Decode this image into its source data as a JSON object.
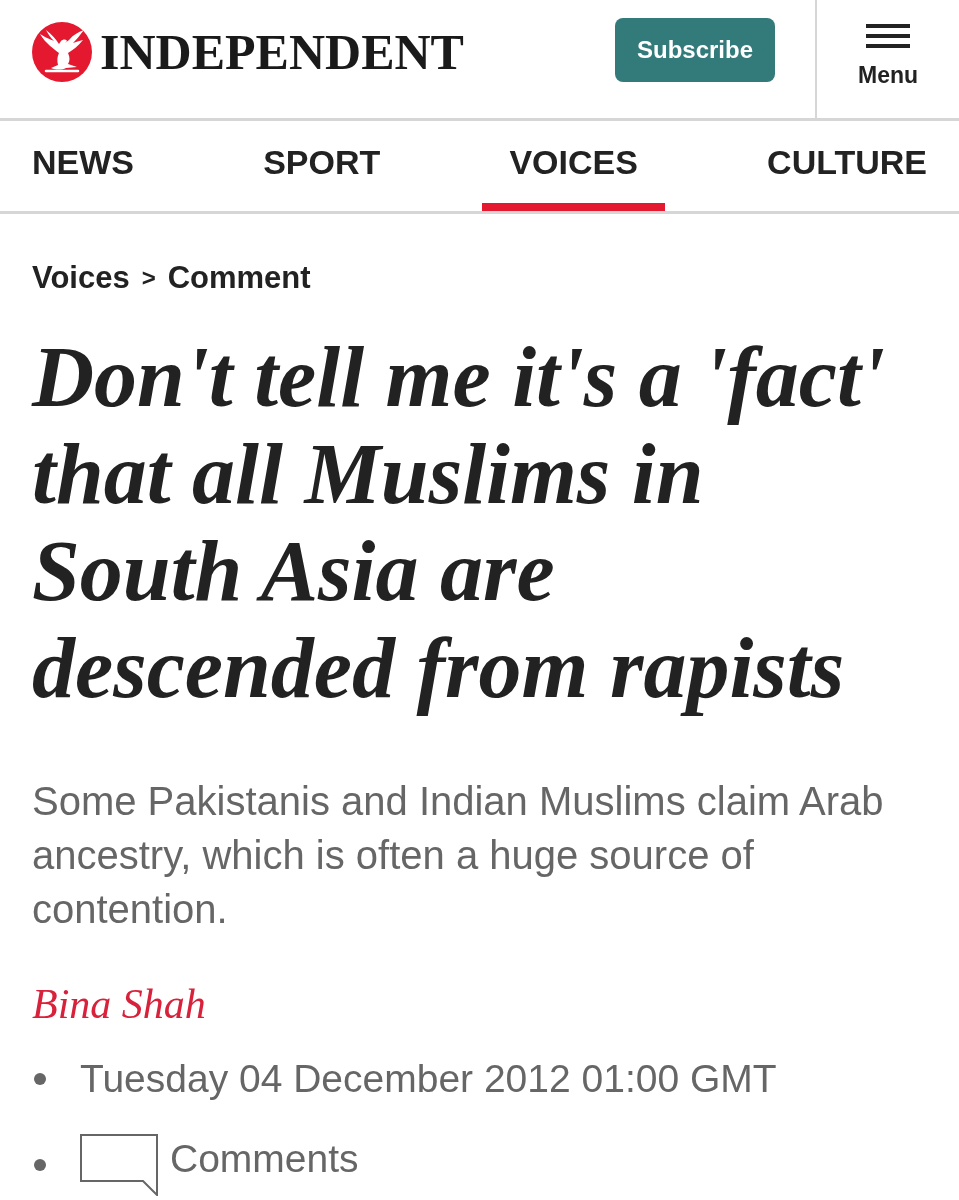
{
  "masthead": {
    "logo_text": "INDEPENDENT"
  },
  "subscribe_button": {
    "label": "Subscribe"
  },
  "menu_button": {
    "label": "Menu"
  },
  "nav_tabs": [
    {
      "label": "NEWS",
      "selected": false
    },
    {
      "label": "SPORT",
      "selected": false
    },
    {
      "label": "VOICES",
      "selected": true
    },
    {
      "label": "CULTURE",
      "selected": false
    }
  ],
  "breadcrumb": {
    "items": [
      "Voices",
      "Comment"
    ],
    "separator": ">"
  },
  "article": {
    "headline": "Don't tell me it's a 'fact' that all Muslims in South Asia are descended from rapists",
    "standfirst": "Some Pakistanis and Indian Muslims claim Arab ancestry, which is often a huge source of contention.",
    "author": "Bina Shah",
    "meta": [
      {
        "kind": "date",
        "text": "Tuesday 04 December 2012 01:00 GMT"
      },
      {
        "kind": "comments",
        "text": "Comments"
      }
    ]
  }
}
